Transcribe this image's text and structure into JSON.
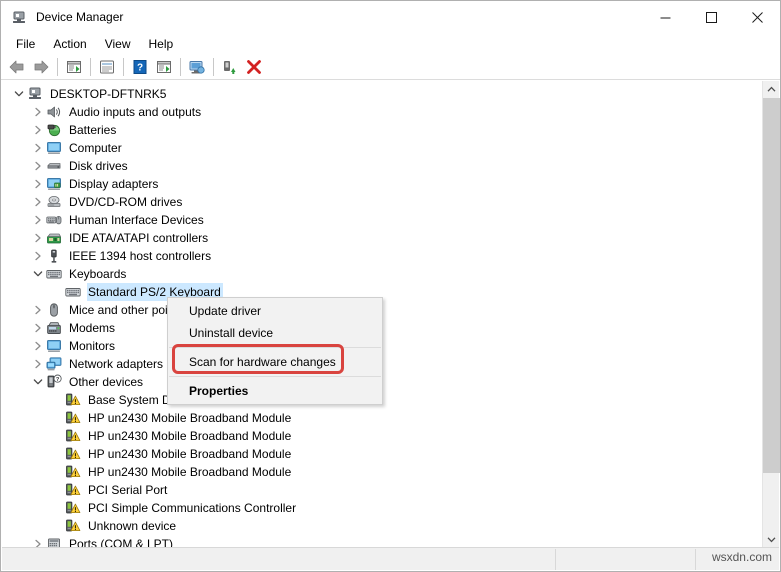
{
  "window": {
    "title": "Device Manager",
    "title_icon": "device-manager-icon",
    "caption": {
      "minimize": "—",
      "maximize": "□",
      "close": "✕"
    }
  },
  "menubar": {
    "items": [
      {
        "label": "File"
      },
      {
        "label": "Action"
      },
      {
        "label": "View"
      },
      {
        "label": "Help"
      }
    ]
  },
  "toolbar": {
    "buttons": [
      {
        "name": "back-icon",
        "tip": "Back"
      },
      {
        "name": "forward-icon",
        "tip": "Forward"
      },
      {
        "name": "separator",
        "tip": ""
      },
      {
        "name": "show-hidden-devices-icon",
        "tip": "Show hidden devices"
      },
      {
        "name": "separator",
        "tip": ""
      },
      {
        "name": "properties-icon",
        "tip": "Properties"
      },
      {
        "name": "separator",
        "tip": ""
      },
      {
        "name": "help-icon",
        "tip": "Help"
      },
      {
        "name": "update-driver-icon",
        "tip": "Update driver"
      },
      {
        "name": "separator",
        "tip": ""
      },
      {
        "name": "scan-for-hardware-changes-icon",
        "tip": "Scan for hardware changes"
      },
      {
        "name": "separator",
        "tip": ""
      },
      {
        "name": "uninstall-device-icon",
        "tip": "Uninstall device"
      },
      {
        "name": "delete-icon",
        "tip": "Delete"
      }
    ]
  },
  "tree": {
    "rows": [
      {
        "label": "DESKTOP-DFTNRK5",
        "indent": 0,
        "twisty": "expanded",
        "icon": "computer-root-icon"
      },
      {
        "label": "Audio inputs and outputs",
        "indent": 1,
        "twisty": "collapsed",
        "icon": "speaker-icon"
      },
      {
        "label": "Batteries",
        "indent": 1,
        "twisty": "collapsed",
        "icon": "battery-icon"
      },
      {
        "label": "Computer",
        "indent": 1,
        "twisty": "collapsed",
        "icon": "monitor-icon"
      },
      {
        "label": "Disk drives",
        "indent": 1,
        "twisty": "collapsed",
        "icon": "disk-drive-icon"
      },
      {
        "label": "Display adapters",
        "indent": 1,
        "twisty": "collapsed",
        "icon": "display-adapter-icon"
      },
      {
        "label": "DVD/CD-ROM drives",
        "indent": 1,
        "twisty": "collapsed",
        "icon": "optical-drive-icon"
      },
      {
        "label": "Human Interface Devices",
        "indent": 1,
        "twisty": "collapsed",
        "icon": "hid-icon"
      },
      {
        "label": "IDE ATA/ATAPI controllers",
        "indent": 1,
        "twisty": "collapsed",
        "icon": "ide-controller-icon"
      },
      {
        "label": "IEEE 1394 host controllers",
        "indent": 1,
        "twisty": "collapsed",
        "icon": "ieee1394-icon"
      },
      {
        "label": "Keyboards",
        "indent": 1,
        "twisty": "expanded",
        "icon": "keyboard-icon"
      },
      {
        "label": "Standard PS/2 Keyboard",
        "indent": 2,
        "twisty": "none",
        "icon": "keyboard-icon",
        "selected": true
      },
      {
        "label": "Mice and other pointing devices",
        "indent": 1,
        "twisty": "collapsed",
        "icon": "mouse-icon"
      },
      {
        "label": "Modems",
        "indent": 1,
        "twisty": "collapsed",
        "icon": "modem-icon"
      },
      {
        "label": "Monitors",
        "indent": 1,
        "twisty": "collapsed",
        "icon": "monitor-icon"
      },
      {
        "label": "Network adapters",
        "indent": 1,
        "twisty": "collapsed",
        "icon": "network-adapter-icon"
      },
      {
        "label": "Other devices",
        "indent": 1,
        "twisty": "expanded",
        "icon": "unknown-device-icon"
      },
      {
        "label": "Base System Device",
        "indent": 2,
        "twisty": "none",
        "icon": "warning-device-icon"
      },
      {
        "label": "HP un2430 Mobile Broadband Module",
        "indent": 2,
        "twisty": "none",
        "icon": "warning-device-icon"
      },
      {
        "label": "HP un2430 Mobile Broadband Module",
        "indent": 2,
        "twisty": "none",
        "icon": "warning-device-icon"
      },
      {
        "label": "HP un2430 Mobile Broadband Module",
        "indent": 2,
        "twisty": "none",
        "icon": "warning-device-icon"
      },
      {
        "label": "HP un2430 Mobile Broadband Module",
        "indent": 2,
        "twisty": "none",
        "icon": "warning-device-icon"
      },
      {
        "label": "PCI Serial Port",
        "indent": 2,
        "twisty": "none",
        "icon": "warning-device-icon"
      },
      {
        "label": "PCI Simple Communications Controller",
        "indent": 2,
        "twisty": "none",
        "icon": "warning-device-icon"
      },
      {
        "label": "Unknown device",
        "indent": 2,
        "twisty": "none",
        "icon": "warning-device-icon"
      },
      {
        "label": "Ports (COM & LPT)",
        "indent": 1,
        "twisty": "collapsed",
        "icon": "port-icon"
      }
    ]
  },
  "context_menu": {
    "items": [
      {
        "label": "Update driver",
        "bold": false,
        "separator_after": false
      },
      {
        "label": "Uninstall device",
        "bold": false,
        "separator_after": true
      },
      {
        "label": "Scan for hardware changes",
        "bold": false,
        "separator_after": true,
        "highlighted": true
      },
      {
        "label": "Properties",
        "bold": true,
        "separator_after": false
      }
    ]
  },
  "scrollbar": {
    "up_arrow": "⌃",
    "down_arrow": "⌄"
  },
  "statusbar": {
    "text": "",
    "watermark": "wsxdn.com"
  },
  "colors": {
    "selection": "#cce8ff",
    "highlight_red": "#d9443f",
    "menu_bg": "#f2f2f2",
    "chrome_bg": "#f0f0f0"
  }
}
